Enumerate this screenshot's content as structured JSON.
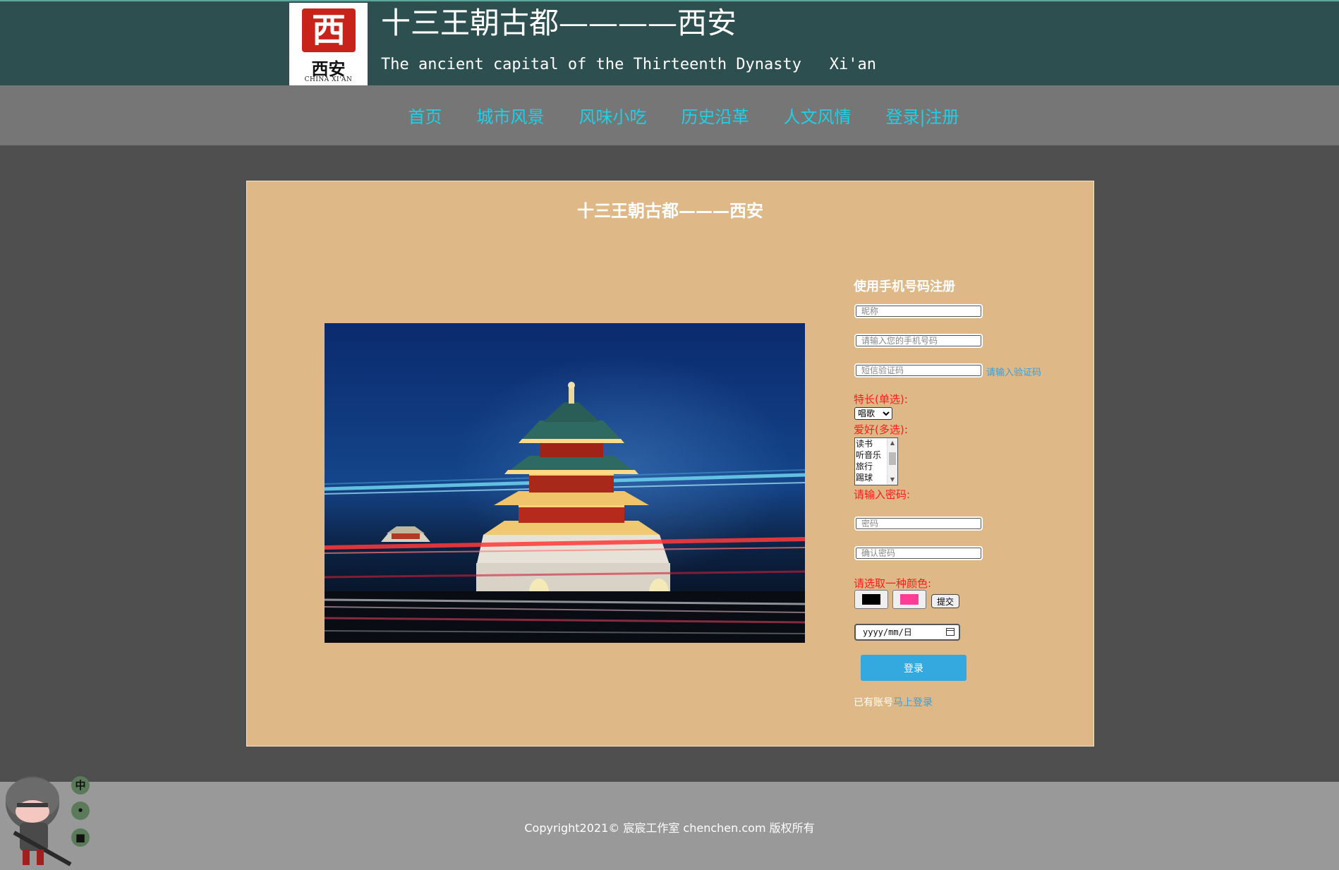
{
  "header": {
    "logo": {
      "seal_glyph": "西",
      "cn": "西安",
      "en": "CHINA XI'AN"
    },
    "title": "十三王朝古都————西安",
    "subtitle": "The ancient capital of the Thirteenth Dynasty   Xi'an"
  },
  "nav": {
    "items": [
      "首页",
      "城市风景",
      "风味小吃",
      "历史沿革",
      "人文风情",
      "登录|注册"
    ]
  },
  "main": {
    "title": "十三王朝古都———西安"
  },
  "form": {
    "title": "使用手机号码注册",
    "nickname_placeholder": "昵称",
    "phone_placeholder": "请输入您的手机号码",
    "sms_placeholder": "短信验证码",
    "sms_link": "请输入验证码",
    "skill_label": "特长(单选):",
    "skill_selected": "唱歌",
    "hobby_label": "爱好(多选):",
    "hobby_options": [
      "读书",
      "听音乐",
      "旅行",
      "踢球"
    ],
    "password_label": "请输入密码:",
    "password_placeholder": "密码",
    "confirm_placeholder": "确认密码",
    "color_label": "请选取一种颜色:",
    "color1": "#000000",
    "color2": "#ff3d96",
    "submit_label": "提交",
    "date_value": "yyyy/mm/日",
    "login_label": "登录",
    "account_text": "已有账号",
    "account_link": "马上登录"
  },
  "footer": {
    "copyright": "Copyright2021© 宸宸工作室 chenchen.com 版权所有"
  },
  "side_icons": [
    {
      "glyph": "中",
      "icon": "chinese-icon"
    },
    {
      "glyph": "•",
      "icon": "dots-icon"
    },
    {
      "glyph": "■",
      "icon": "shirt-icon"
    }
  ],
  "colors": {
    "header_bg": "#2d4f4f",
    "nav_bg": "#767676",
    "nav_link": "#1ed0e6",
    "card_bg": "#deb887",
    "accent_blue": "#33a9e0",
    "label_red": "#ff1a1a"
  }
}
